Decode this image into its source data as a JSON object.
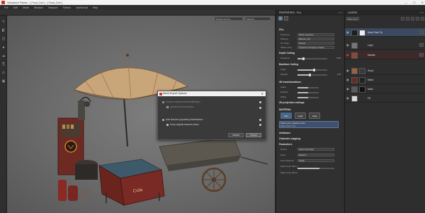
{
  "window": {
    "title": "Substance Painter - [ Food_Cart ] - [ Food_Cart ]",
    "minimize": "—",
    "maximize": "☐",
    "close": "✕"
  },
  "menu": [
    "File",
    "Edit",
    "Mode",
    "Window",
    "Viewport",
    "Python",
    "JavaScript",
    "Help"
  ],
  "viewport_toolbar": {
    "display_mode": "Default camera",
    "channel": "Material"
  },
  "tools": [
    "brush",
    "eraser",
    "projection",
    "geometry-mask",
    "smudge",
    "clone",
    "picker",
    "fill"
  ],
  "dialog": {
    "title": "Mesh Export Options",
    "close": "✕",
    "option1_label": "Custom replacement/modification",
    "option1_sub": "Update all occurrences",
    "option2_label": "Add textures (dynamic)/modification",
    "option2_sub": "Keep original textures intact",
    "cancel": "Cancel",
    "ok": "Export"
  },
  "properties": {
    "header": "PROPERTIES - FILL",
    "section_fill": "FILL",
    "projection_label": "Projection",
    "projection_value": "Planar projection",
    "filtering_label": "Filtering",
    "filtering_value": "Bilinear | HQ",
    "uv_wrap_label": "UV Wrap",
    "uv_wrap_value": "Repeat",
    "shape_crop_label": "Shape Crop",
    "shape_crop_value": "Projection Cropped to Shape",
    "section_depth": "Depth Culling",
    "hardness_label": "Hardness",
    "hardness_value": "0.15",
    "section_backface": "Backface Culling",
    "angle_label": "Angle",
    "falloff_label": "Fall-Off",
    "falloff_value": "1.75",
    "section_3d": "3D transformations",
    "scale_label": "Scale",
    "rotation_label": "Rotation",
    "offset_label": "Offset",
    "section_2d": "2D projection settings",
    "section_material": "MATERIAL",
    "mat_color": "color",
    "mat_rough": "rough",
    "mat_metal": "metal",
    "material_name": "Select your material mode",
    "material_sub": "Basic Paint Tips",
    "section_attributes": "Attributes",
    "section_channels": "Channels mapping",
    "section_parameters": "Parameters",
    "preset_label": "Preset",
    "preset_value": "Select and Apply",
    "seed_label": "Seed",
    "seed_value": "Random",
    "dust_label": "Dust Selection",
    "dust_value": "Shade",
    "mask_label": "Mask Color Mult 1",
    "mask2_label": "Mask Color Mult 2"
  },
  "layers": {
    "header": "LAYERS",
    "blend": "Base Color",
    "items": [
      {
        "name": "Black Paint Tip",
        "selected": true
      },
      {
        "name": "Layer",
        "selected": false
      },
      {
        "name": "Metallic",
        "selected": false
      },
      {
        "name": "Wood",
        "selected": false
      },
      {
        "name": "Metal",
        "selected": false
      },
      {
        "name": "Mask",
        "selected": false
      },
      {
        "name": "Fill",
        "selected": false
      }
    ]
  },
  "colors": {
    "accent": "#5a7aa8",
    "selection": "#3b4a60",
    "cart_red": "#8a2a22",
    "umbrella": "#c9a57a"
  }
}
